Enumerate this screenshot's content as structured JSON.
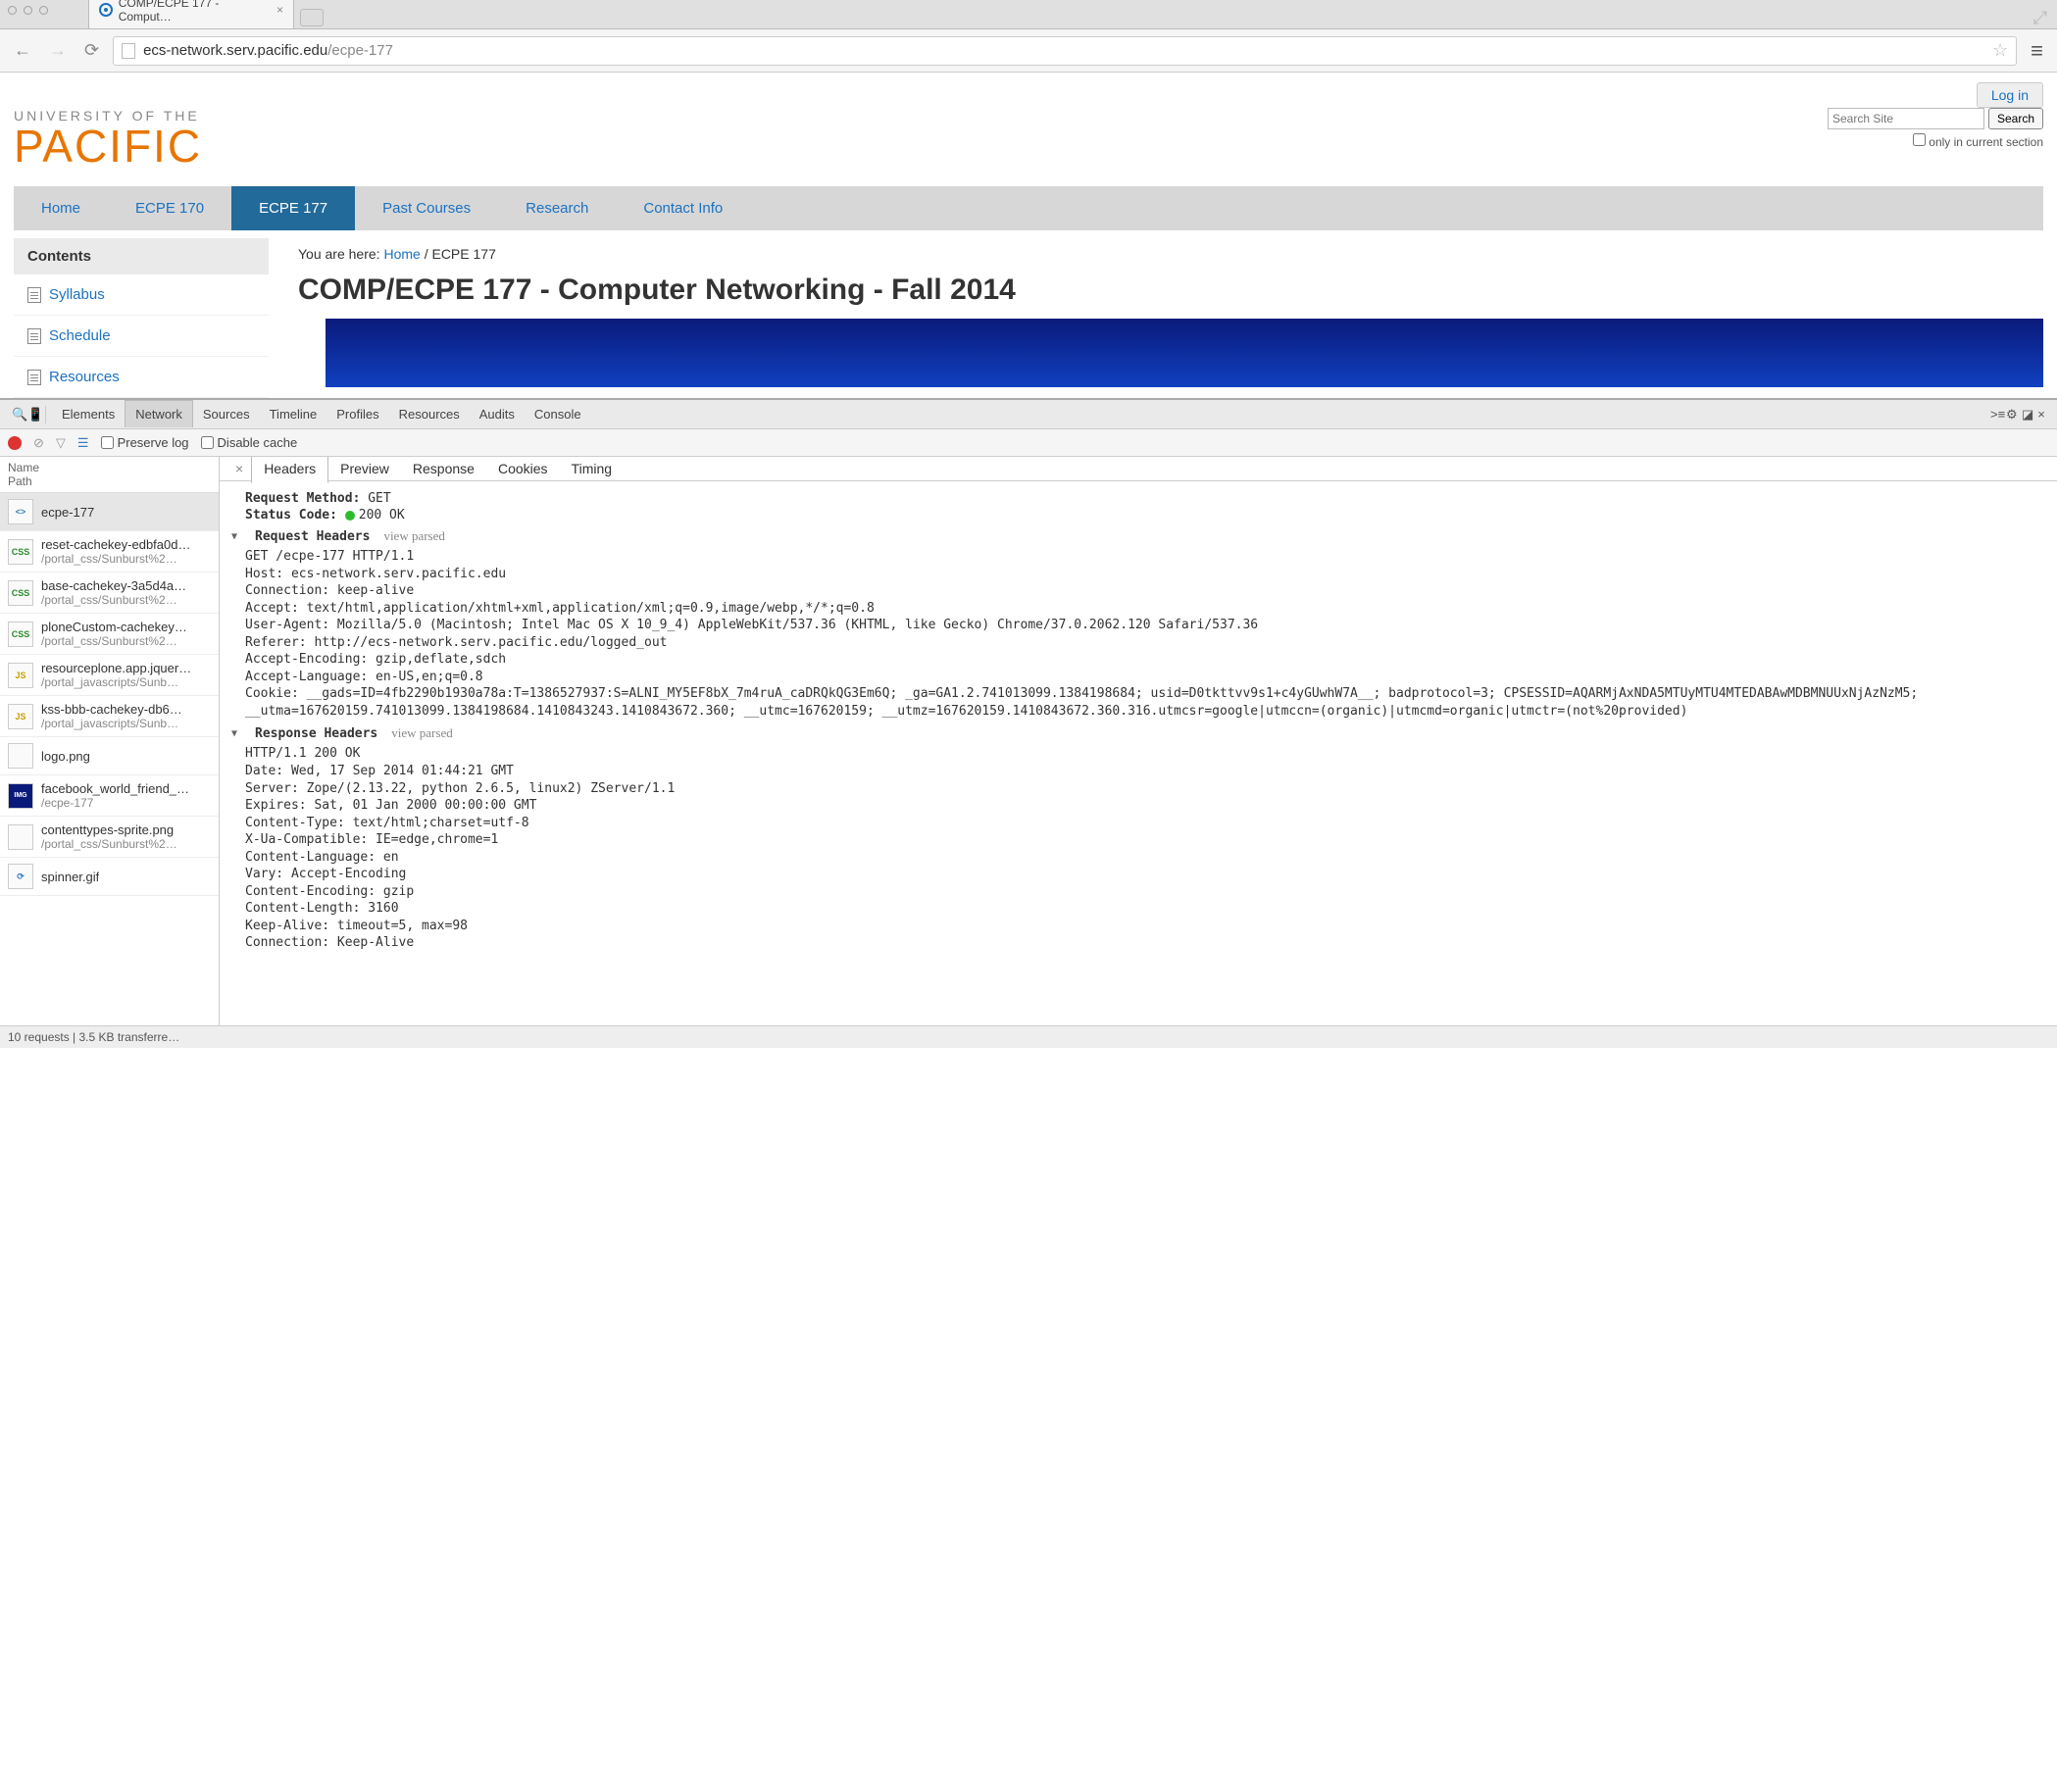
{
  "browser": {
    "tab_title": "COMP/ECPE 177 - Comput…",
    "url_domain": "ecs-network.serv.pacific.edu",
    "url_path": "/ecpe-177"
  },
  "page": {
    "login": "Log in",
    "logo_top": "UNIVERSITY OF THE",
    "logo_main": "PACIFIC",
    "search_placeholder": "Search Site",
    "search_button": "Search",
    "only_section": "only in current section",
    "nav": [
      "Home",
      "ECPE 170",
      "ECPE 177",
      "Past Courses",
      "Research",
      "Contact Info"
    ],
    "nav_active": 2,
    "sidebar_title": "Contents",
    "sidebar": [
      "Syllabus",
      "Schedule",
      "Resources"
    ],
    "breadcrumb_prefix": "You are here: ",
    "breadcrumb_home": "Home",
    "breadcrumb_sep": " / ",
    "breadcrumb_current": "ECPE 177",
    "title": "COMP/ECPE 177 - Computer Networking - Fall 2014"
  },
  "devtools": {
    "tabs": [
      "Elements",
      "Network",
      "Sources",
      "Timeline",
      "Profiles",
      "Resources",
      "Audits",
      "Console"
    ],
    "active_tab": 1,
    "preserve_log": "Preserve log",
    "disable_cache": "Disable cache",
    "list_header_name": "Name",
    "list_header_path": "Path",
    "requests": [
      {
        "name": "ecpe-177",
        "path": "",
        "badge": "<>",
        "sel": true
      },
      {
        "name": "reset-cachekey-edbfa0d…",
        "path": "/portal_css/Sunburst%2…",
        "badge": "CSS"
      },
      {
        "name": "base-cachekey-3a5d4a…",
        "path": "/portal_css/Sunburst%2…",
        "badge": "CSS"
      },
      {
        "name": "ploneCustom-cachekey…",
        "path": "/portal_css/Sunburst%2…",
        "badge": "CSS"
      },
      {
        "name": "resourceplone.app.jquer…",
        "path": "/portal_javascripts/Sunb…",
        "badge": "JS"
      },
      {
        "name": "kss-bbb-cachekey-db6…",
        "path": "/portal_javascripts/Sunb…",
        "badge": "JS"
      },
      {
        "name": "logo.png",
        "path": "",
        "badge": ""
      },
      {
        "name": "facebook_world_friend_…",
        "path": "/ecpe-177",
        "badge": "IMG"
      },
      {
        "name": "contenttypes-sprite.png",
        "path": "/portal_css/Sunburst%2…",
        "badge": ""
      },
      {
        "name": "spinner.gif",
        "path": "",
        "badge": "⟳"
      }
    ],
    "detail_tabs": [
      "Headers",
      "Preview",
      "Response",
      "Cookies",
      "Timing"
    ],
    "detail_active": 0,
    "request_method_label": "Request Method:",
    "request_method": "GET",
    "status_label": "Status Code:",
    "status_value": "200 OK",
    "req_hdr_title": "Request Headers",
    "view_parsed": "view parsed",
    "req_hdr": "GET /ecpe-177 HTTP/1.1\nHost: ecs-network.serv.pacific.edu\nConnection: keep-alive\nAccept: text/html,application/xhtml+xml,application/xml;q=0.9,image/webp,*/*;q=0.8\nUser-Agent: Mozilla/5.0 (Macintosh; Intel Mac OS X 10_9_4) AppleWebKit/537.36 (KHTML, like Gecko) Chrome/37.0.2062.120 Safari/537.36\nReferer: http://ecs-network.serv.pacific.edu/logged_out\nAccept-Encoding: gzip,deflate,sdch\nAccept-Language: en-US,en;q=0.8\nCookie: __gads=ID=4fb2290b1930a78a:T=1386527937:S=ALNI_MY5EF8bX_7m4ruA_caDRQkQG3Em6Q; _ga=GA1.2.741013099.1384198684; usid=D0tkttvv9s1+c4yGUwhW7A__; badprotocol=3; CPSESSID=AQARMjAxNDA5MTUyMTU4MTEDABAwMDBMNUUxNjAzNzM5; __utma=167620159.741013099.1384198684.1410843243.1410843672.360; __utmc=167620159; __utmz=167620159.1410843672.360.316.utmcsr=google|utmccn=(organic)|utmcmd=organic|utmctr=(not%20provided)",
    "res_hdr_title": "Response Headers",
    "res_hdr": "HTTP/1.1 200 OK\nDate: Wed, 17 Sep 2014 01:44:21 GMT\nServer: Zope/(2.13.22, python 2.6.5, linux2) ZServer/1.1\nExpires: Sat, 01 Jan 2000 00:00:00 GMT\nContent-Type: text/html;charset=utf-8\nX-Ua-Compatible: IE=edge,chrome=1\nContent-Language: en\nVary: Accept-Encoding\nContent-Encoding: gzip\nContent-Length: 3160\nKeep-Alive: timeout=5, max=98\nConnection: Keep-Alive",
    "footer": "10 requests | 3.5 KB transferre…"
  }
}
